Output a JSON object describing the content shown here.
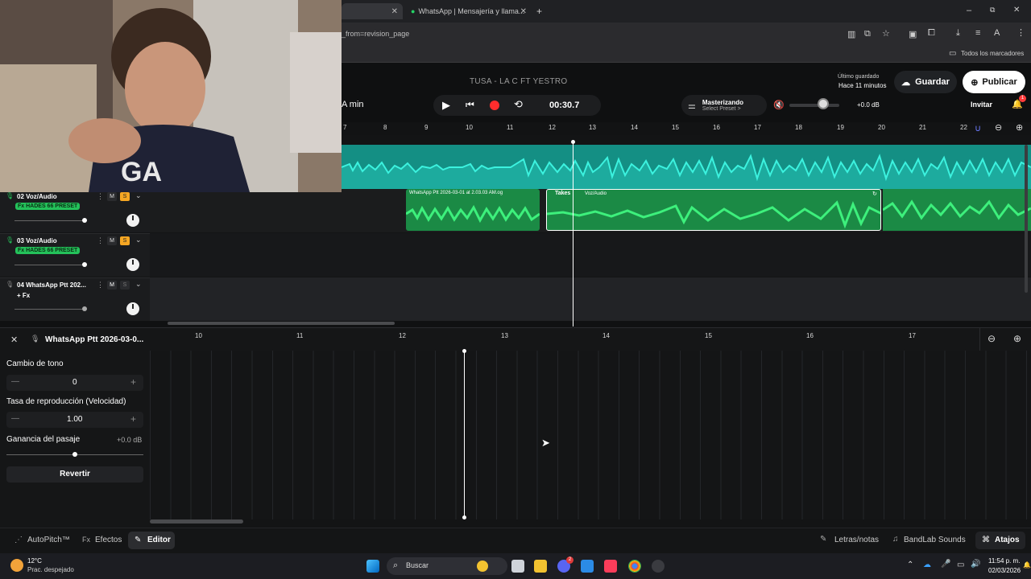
{
  "browser": {
    "tabs": [
      {
        "title": "",
        "active": false
      },
      {
        "title": "WhatsApp | Mensajería y llama...",
        "active": false
      }
    ],
    "new_tab": "+",
    "url": "_from=revision_page",
    "bookmarks_label": "Todos los marcadores",
    "window_min": "–",
    "window_max": "⧉",
    "window_close": "✕"
  },
  "header": {
    "song_title": "TUSA - LA C FT YESTRO",
    "saved_line1": "Último guardado",
    "saved_line2": "Hace 11 minutos",
    "save_label": "Guardar",
    "publish_label": "Publicar",
    "left_partial": "A min",
    "time": "00:30.7",
    "mastering_title": "Masterizando",
    "mastering_preset": "Select Preset >",
    "volume_db": "+0.0 dB",
    "invite_label": "Invitar",
    "notification_count": "1"
  },
  "ruler": {
    "ticks": [
      "7",
      "8",
      "9",
      "10",
      "11",
      "12",
      "13",
      "14",
      "15",
      "16",
      "17",
      "18",
      "19",
      "20",
      "21",
      "22"
    ]
  },
  "tracks": [
    {
      "name": "02 Voz/Audio",
      "fx": "Fx HADES 66 PRESET",
      "mute": "M",
      "solo": "S",
      "solo_active": true
    },
    {
      "name": "03 Voz/Audio",
      "fx": "Fx HADES 66 PRESET",
      "mute": "M",
      "solo": "S",
      "solo_active": true
    },
    {
      "name": "04 WhatsApp Ptt 202...",
      "fx": "+ Fx",
      "mute": "M",
      "solo": "S",
      "solo_active": false
    }
  ],
  "clips": {
    "whatsapp_clip": "WhatsApp Ptt 2026-03-01 at 2.03.03 AM.og",
    "takes_label": "Takes",
    "voz_clip": "Voz/Audio"
  },
  "editor": {
    "clip_name": "WhatsApp Ptt 2026-03-0...",
    "pitch_label": "Cambio de tono",
    "pitch_value": "0",
    "rate_label": "Tasa de reproducción (Velocidad)",
    "rate_value": "1.00",
    "gain_label": "Ganancia del pasaje",
    "gain_value": "+0.0 dB",
    "revert_label": "Revertir",
    "ruler_ticks": [
      "10",
      "11",
      "12",
      "13",
      "14",
      "15",
      "16",
      "17"
    ]
  },
  "footer": {
    "autopitch": "AutoPitch™",
    "effects": "Efectos",
    "editor": "Editor",
    "lyrics": "Letras/notas",
    "sounds": "BandLab Sounds",
    "shortcuts": "Atajos"
  },
  "taskbar": {
    "temp": "12°C",
    "weather": "Prac. despejado",
    "search_placeholder": "Buscar",
    "time": "11:54 p. m.",
    "date": "02/03/2026",
    "discord_badge": "2"
  },
  "colors": {
    "teal_clip": "#1fc7b5",
    "green_clip": "#2bd66a",
    "fx_badge": "#24c15a",
    "solo_badge": "#f5a623",
    "record": "#ff2d2d"
  }
}
